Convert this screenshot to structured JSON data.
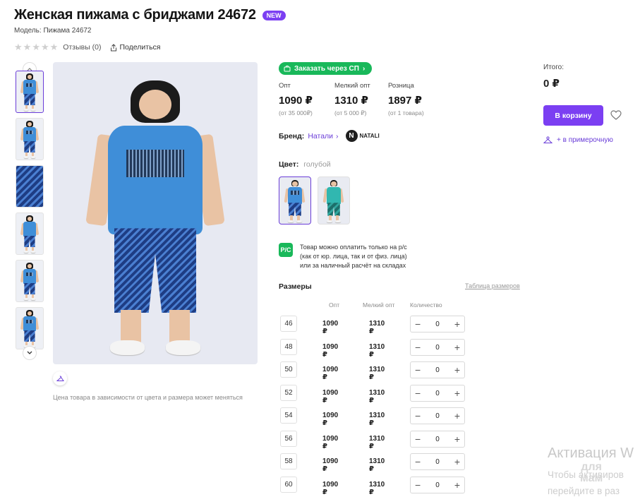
{
  "product": {
    "title": "Женская пижама с бриджами 24672",
    "badge": "NEW",
    "model": "Модель: Пижама 24672",
    "reviews": "Отзывы (0)",
    "share": "Поделиться",
    "rating_stars": 0
  },
  "image_note": "Цена товара в зависимости от цвета и размера может меняться",
  "order_sp": "Заказать через СП",
  "prices": [
    {
      "label": "Опт",
      "value": "1090 ₽",
      "min": "(от 35 000₽)"
    },
    {
      "label": "Мелкий опт",
      "value": "1310 ₽",
      "min": "(от 5 000 ₽)"
    },
    {
      "label": "Розница",
      "value": "1897 ₽",
      "min": "(от 1 товара)"
    }
  ],
  "brand": {
    "label": "Бренд:",
    "name": "Натали",
    "logo_letter": "N",
    "logo_text": "NATALI"
  },
  "color": {
    "label": "Цвет:",
    "value": "голубой"
  },
  "payment": {
    "icon_text": "Р/С",
    "line1": "Товар можно оплатить только на р/с",
    "line2": "(как от юр. лица, так и от физ. лица)",
    "line3": "или за наличный расчёт на складах"
  },
  "sizes": {
    "title": "Размеры",
    "table_link": "Таблица размеров",
    "headers": {
      "opt": "Опт",
      "small_opt": "Мелкий опт",
      "qty": "Количество"
    },
    "rows": [
      {
        "size": "46",
        "opt": "1090 ₽",
        "small_opt": "1310 ₽",
        "qty": "0"
      },
      {
        "size": "48",
        "opt": "1090 ₽",
        "small_opt": "1310 ₽",
        "qty": "0"
      },
      {
        "size": "50",
        "opt": "1090 ₽",
        "small_opt": "1310 ₽",
        "qty": "0"
      },
      {
        "size": "52",
        "opt": "1090 ₽",
        "small_opt": "1310 ₽",
        "qty": "0"
      },
      {
        "size": "54",
        "opt": "1090 ₽",
        "small_opt": "1310 ₽",
        "qty": "0"
      },
      {
        "size": "56",
        "opt": "1090 ₽",
        "small_opt": "1310 ₽",
        "qty": "0"
      },
      {
        "size": "58",
        "opt": "1090 ₽",
        "small_opt": "1310 ₽",
        "qty": "0"
      },
      {
        "size": "60",
        "opt": "1090 ₽",
        "small_opt": "1310 ₽",
        "qty": "0"
      }
    ]
  },
  "summary": {
    "total_label": "Итого:",
    "total_value": "0 ₽",
    "cart_button": "В корзину",
    "fitting_link": "+ в примерочную"
  },
  "watermark": {
    "title": "Активация W",
    "line1": "Чтобы активиров",
    "line2": "перейдите в раз",
    "logo_line1": "для",
    "logo_line2": "мам"
  },
  "colors": {
    "accent": "#7b3ff2",
    "green": "#19b85a",
    "link": "#6a3dd8"
  }
}
